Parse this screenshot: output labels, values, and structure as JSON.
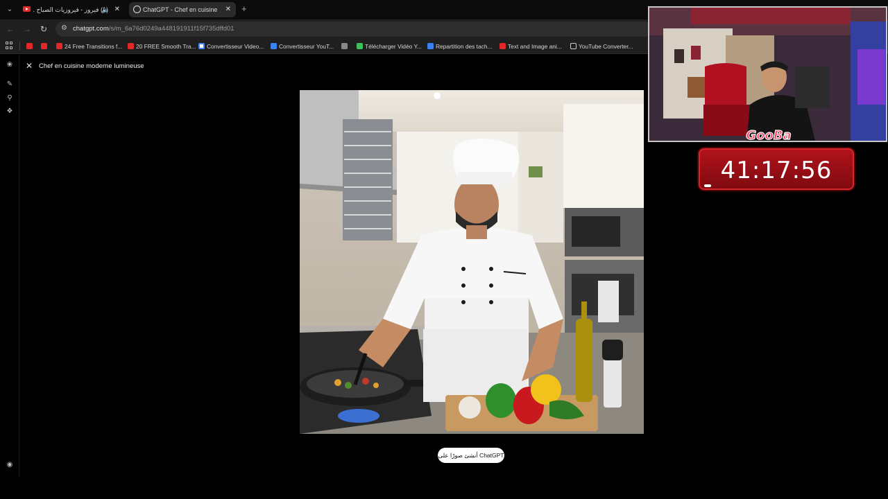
{
  "tabs": [
    {
      "title": "(1) فيروز - فيروزيات الصباح ...",
      "favicon": "youtube-icon",
      "audio": true
    },
    {
      "title": "ChatGPT - Chef en cuisine mod",
      "favicon": "chatgpt-icon",
      "active": true
    }
  ],
  "address_bar": {
    "host": "chatgpt.com",
    "path": "/s/m_6a76d0249a448191911f15f735dffd01"
  },
  "bookmarks": [
    {
      "label": "",
      "icon": "youtube-icon"
    },
    {
      "label": "",
      "icon": "youtube-icon"
    },
    {
      "label": "24 Free Transitions f...",
      "icon": "youtube-icon"
    },
    {
      "label": "20 FREE Smooth Tra...",
      "icon": "youtube-icon"
    },
    {
      "label": "Convertisseur Video...",
      "icon": "google-icon"
    },
    {
      "label": "Convertisseur YouT...",
      "icon": "converter-icon"
    },
    {
      "label": "",
      "icon": "globe-icon"
    },
    {
      "label": "Télécharger Vidéo Y...",
      "icon": "download-icon"
    },
    {
      "label": "Repartition des tach...",
      "icon": "docs-icon"
    },
    {
      "label": "Text and Image ani...",
      "icon": "youtube-icon"
    },
    {
      "label": "YouTube Converter...",
      "icon": "clock-icon"
    }
  ],
  "viewer": {
    "title": "Chef en cuisine moderne lumineuse",
    "cta_label": "أنشئ صورًا على ChatGPT"
  },
  "overlay": {
    "channel_logo": "GooBa",
    "timer": "41:17:56",
    "colors": {
      "timer_red": "#b3131b",
      "timer_text": "#ffffff"
    }
  },
  "theme": {
    "background": "#000000",
    "chrome": "#1f1f1f"
  }
}
